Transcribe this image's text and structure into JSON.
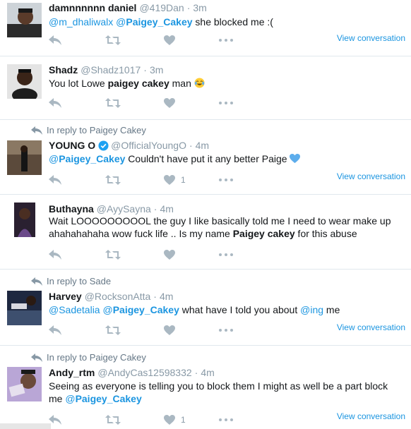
{
  "colors": {
    "link": "#1b95e0",
    "muted": "#8899a6",
    "icon": "#aab8c2",
    "heart_emoji": "#5dadec"
  },
  "view_conversation_label": "View conversation",
  "tweets": [
    {
      "name": "damnnnnnn daniel",
      "handle": "@419Dan",
      "sep": "·",
      "time": "3m",
      "text": {
        "m1": "@m_dhaliwalx",
        "m2": "@",
        "m2b": "Paigey_Cakey",
        "rest": " she blocked me :("
      },
      "view_conversation": "View conversation"
    },
    {
      "name": "Shadz",
      "handle": "@Shadz1017",
      "sep": "·",
      "time": "3m",
      "text": {
        "t1": "You lot Lowe ",
        "k1": "paigey",
        "t2": " ",
        "k2": "cakey",
        "t3": " man ",
        "emoji": "face-with-tears-of-joy"
      }
    },
    {
      "reply_to": "In reply to Paigey Cakey",
      "name": "YOUNG O",
      "verified": true,
      "handle": "@OfficialYoungO",
      "sep": "·",
      "time": "4m",
      "text": {
        "m1": "@",
        "m1b": "Paigey_Cakey",
        "rest": " Couldn't have put it any better Paige ",
        "emoji": "blue-heart"
      },
      "likes": "1",
      "view_conversation": "View conversation"
    },
    {
      "name": "Buthayna",
      "handle": "@AyySayna",
      "sep": "·",
      "time": "4m",
      "text": {
        "line1": "Wait LOOOOOOOOOL the guy I like basically told me I need to wear make up",
        "line2a": "ahahahahaha wow fuck life .. Is my name ",
        "k1": "Paigey",
        "sp": " ",
        "k2": "cakey",
        "line2b": " for this abuse"
      }
    },
    {
      "reply_to": "In reply to Sade",
      "name": "Harvey",
      "handle": "@RocksonAtta",
      "sep": "·",
      "time": "4m",
      "text": {
        "m1": "@Sadetalia",
        "m2": "@",
        "m2b": "Paigey_Cakey",
        "t1": " what have I told you about ",
        "m3": "@ing",
        "t2": " me"
      },
      "view_conversation": "View conversation"
    },
    {
      "reply_to": "In reply to Paigey Cakey",
      "name": "Andy_rtm",
      "handle": "@AndyCas12598332",
      "sep": "·",
      "time": "4m",
      "text": {
        "line1": "Seeing as everyone is telling you to block them I might as well be a part block",
        "line2a": "me ",
        "m1": "@",
        "m1b": "Paigey_Cakey"
      },
      "likes": "1",
      "view_conversation": "View conversation"
    }
  ]
}
